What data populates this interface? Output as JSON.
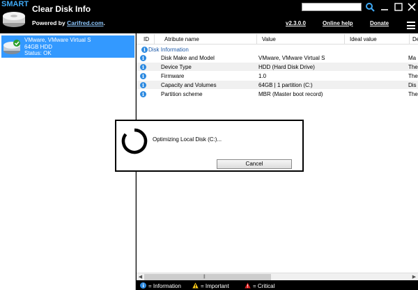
{
  "header": {
    "logo_text": "SMART",
    "title": "Clear Disk Info",
    "powered_prefix": "Powered by ",
    "powered_link": "Carifred.com",
    "powered_suffix": ".",
    "search_value": "",
    "version_link": "v2.3.0.0",
    "online_help_link": "Online help",
    "donate_link": "Donate"
  },
  "sidebar": {
    "disks": [
      {
        "name": "VMware, VMware Virtual S",
        "size": "64GB HDD",
        "status": "Status: OK"
      }
    ]
  },
  "table": {
    "columns": [
      "ID",
      "Atribute name",
      "Value",
      "Ideal value",
      "De"
    ],
    "group": "Disk Information",
    "rows": [
      {
        "name": "Disk Make and Model",
        "value": "VMware, VMware Virtual S",
        "desc": "Ma"
      },
      {
        "name": "Device Type",
        "value": "HDD (Hard Disk Drive)",
        "desc": "The"
      },
      {
        "name": "Firmware",
        "value": "1.0",
        "desc": "The"
      },
      {
        "name": "Capacity and Volumes",
        "value": "64GB | 1 partition (C:)",
        "desc": "Dis"
      },
      {
        "name": "Partition scheme",
        "value": "MBR (Master boot record)",
        "desc": "The"
      }
    ]
  },
  "legend": {
    "information": "= Information",
    "important": "= Important",
    "critical": "= Critical"
  },
  "dialog": {
    "message": "Optimizing Local Disk (C:)...",
    "cancel_label": "Cancel"
  },
  "colors": {
    "selection": "#3399ff",
    "info_icon": "#2d8ae0",
    "important_icon": "#f5c518",
    "critical_icon": "#e02020",
    "link": "#8ec8ff"
  }
}
